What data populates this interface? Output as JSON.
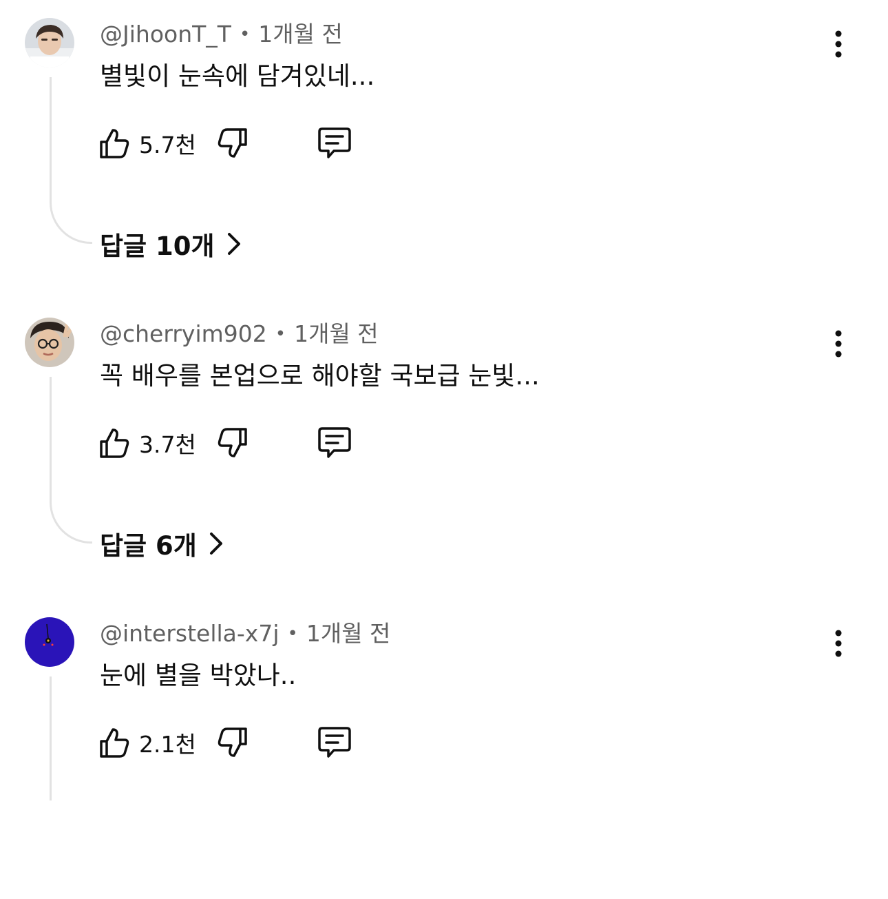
{
  "comments": [
    {
      "handle": "@JihoonT_T",
      "separator": "•",
      "time": "1개월 전",
      "text": "별빛이 눈속에 담겨있네...",
      "likes": "5.7천",
      "replies_label": "답글 10개"
    },
    {
      "handle": "@cherryim902",
      "separator": "•",
      "time": "1개월 전",
      "text": "꼭 배우를 본업으로 해야할 국보급 눈빛...",
      "likes": "3.7천",
      "replies_label": "답글 6개"
    },
    {
      "handle": "@interstella-x7j",
      "separator": "•",
      "time": "1개월 전",
      "text": "눈에 별을 박았나..",
      "likes": "2.1천"
    }
  ],
  "icons": {
    "like": "thumbs-up-icon",
    "dislike": "thumbs-down-icon",
    "reply": "comment-icon",
    "more": "more-vert-icon",
    "expand": "chevron-right-icon"
  },
  "colors": {
    "text": "#0f0f0f",
    "meta": "#606060",
    "thread_line": "#e2e2e2",
    "avatar3_bg": "#2a14b8"
  }
}
